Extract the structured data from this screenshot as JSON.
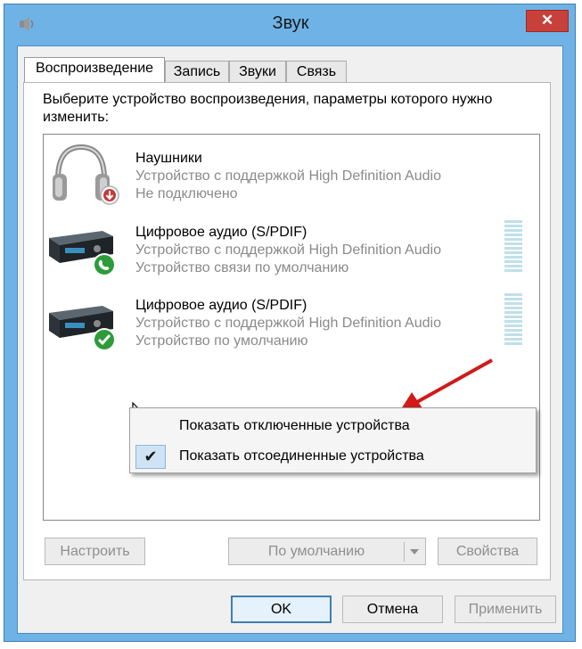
{
  "window": {
    "title": "Звук",
    "close_label": "✕"
  },
  "tabs": [
    {
      "label": "Воспроизведение",
      "active": true
    },
    {
      "label": "Запись",
      "active": false
    },
    {
      "label": "Звуки",
      "active": false
    },
    {
      "label": "Связь",
      "active": false
    }
  ],
  "instruction": "Выберите устройство воспроизведения, параметры которого нужно изменить:",
  "devices": [
    {
      "name": "Наушники",
      "description": "Устройство с поддержкой High Definition Audio",
      "status": "Не подключено",
      "icon": "headphones-icon",
      "badge": "disconnected-badge-icon"
    },
    {
      "name": "Цифровое аудио (S/PDIF)",
      "description": "Устройство с поддержкой High Definition Audio",
      "status": "Устройство связи по умолчанию",
      "icon": "audio-device-icon",
      "badge": "phone-badge-icon"
    },
    {
      "name": "Цифровое аудио (S/PDIF)",
      "description": "Устройство с поддержкой High Definition Audio",
      "status": "Устройство по умолчанию",
      "icon": "audio-device-icon",
      "badge": "checkmark-badge-icon"
    }
  ],
  "context_menu": {
    "items": [
      {
        "label": "Показать отключенные устройства",
        "checked": false
      },
      {
        "label": "Показать отсоединенные устройства",
        "checked": true
      }
    ]
  },
  "buttons": {
    "configure": "Настроить",
    "set_default": "По умолчанию",
    "properties": "Свойства",
    "ok": "OK",
    "cancel": "Отмена",
    "apply": "Применить"
  },
  "colors": {
    "title_bar": "#6fb3e6",
    "close_button": "#c7413a",
    "menu_highlight": "#cfe3f4",
    "annotation_arrow": "#d11a1a"
  }
}
